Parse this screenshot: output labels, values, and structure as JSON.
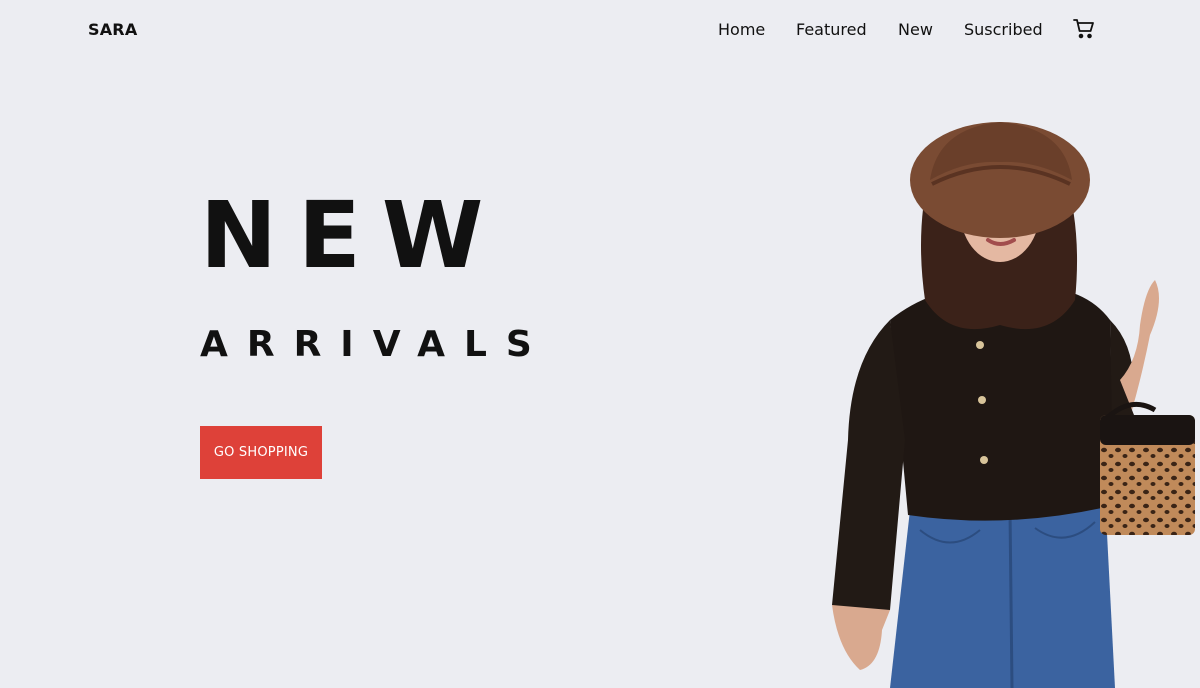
{
  "header": {
    "brand": "SARA",
    "nav": [
      {
        "label": "Home"
      },
      {
        "label": "Featured"
      },
      {
        "label": "New"
      },
      {
        "label": "Suscribed"
      }
    ],
    "cart_icon": "shopping-cart-icon"
  },
  "hero": {
    "title": "NEW",
    "subtitle": "ARRIVALS",
    "cta_label": "GO SHOPPING"
  },
  "colors": {
    "background": "#ecedf2",
    "accent": "#de4139",
    "text": "#111111"
  }
}
